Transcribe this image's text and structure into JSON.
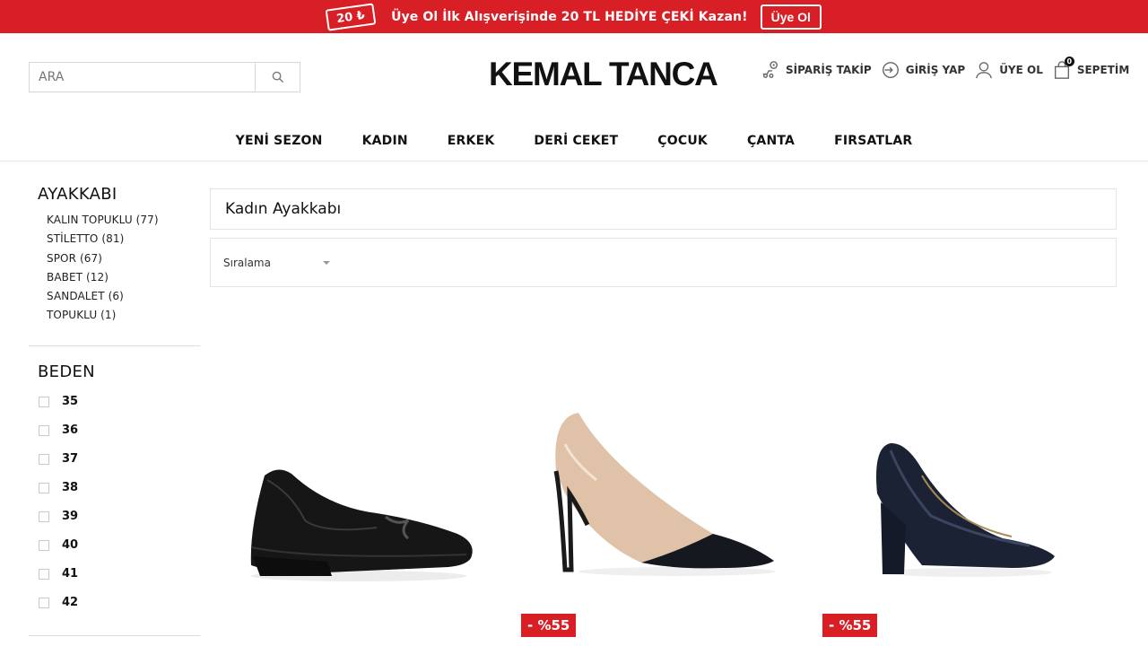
{
  "promo_bar": {
    "coupon_text": "20 ₺",
    "message": "Üye Ol İlk Alışverişinde 20 TL HEDİYE ÇEKİ Kazan!",
    "button_label": "Üye Ol"
  },
  "header": {
    "search_placeholder": "ARA",
    "logo": "KEMAL TANCA",
    "actions": {
      "order_tracking": "SİPARİŞ TAKİP",
      "login": "GİRİŞ YAP",
      "register": "ÜYE OL",
      "cart": "SEPETİM",
      "cart_count": "0"
    }
  },
  "nav": {
    "items": [
      "YENİ SEZON",
      "KADIN",
      "ERKEK",
      "DERİ CEKET",
      "ÇOCUK",
      "ÇANTA",
      "FIRSATLAR"
    ]
  },
  "sidebar": {
    "category_title": "AYAKKABI",
    "categories": [
      "KALIN TOPUKLU (77)",
      "STİLETTO (81)",
      "SPOR (67)",
      "BABET (12)",
      "SANDALET (6)",
      "TOPUKLU (1)"
    ],
    "size_title": "BEDEN",
    "sizes": [
      "35",
      "36",
      "37",
      "38",
      "39",
      "40",
      "41",
      "42"
    ]
  },
  "main": {
    "page_title": "Kadın Ayakkabı",
    "sort_label": "Sıralama"
  },
  "products": [
    {
      "name": "black-wedge-shoe",
      "discount": ""
    },
    {
      "name": "beige-black-stiletto",
      "discount": "- %55"
    },
    {
      "name": "navy-block-heel",
      "discount": "- %55"
    }
  ],
  "colors": {
    "brand_red": "#d81f26",
    "text_dark": "#111111"
  },
  "icons": {
    "search": "search-icon",
    "order_tracking": "truck-pin-icon",
    "login": "login-arrow-icon",
    "register": "user-icon",
    "cart": "shopping-bag-icon"
  }
}
